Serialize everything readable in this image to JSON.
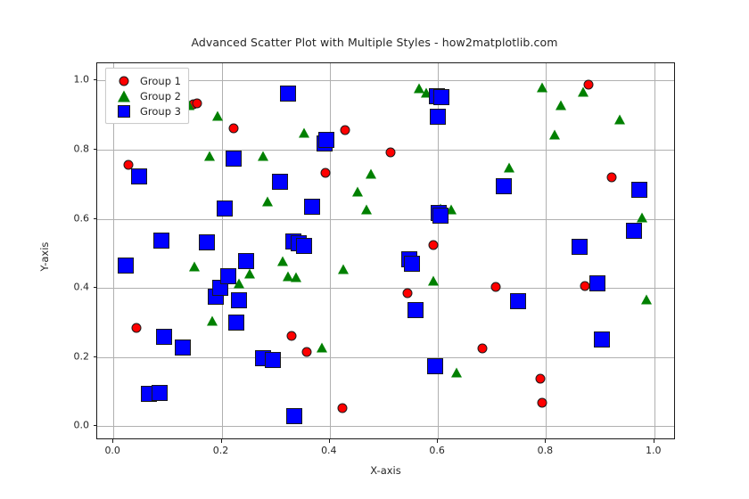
{
  "chart_data": {
    "type": "scatter",
    "title": "Advanced Scatter Plot with Multiple Styles - how2matplotlib.com",
    "xlabel": "X-axis",
    "ylabel": "Y-axis",
    "xlim": [
      -0.03,
      1.04
    ],
    "ylim": [
      -0.04,
      1.05
    ],
    "xticks": [
      0.0,
      0.2,
      0.4,
      0.6,
      0.8,
      1.0
    ],
    "yticks": [
      0.0,
      0.2,
      0.4,
      0.6,
      0.8,
      1.0
    ],
    "xtick_labels": [
      "0.0",
      "0.2",
      "0.4",
      "0.6",
      "0.8",
      "1.0"
    ],
    "ytick_labels": [
      "0.0",
      "0.2",
      "0.4",
      "0.6",
      "0.8",
      "1.0"
    ],
    "grid": true,
    "legend_position": "upper left",
    "series": [
      {
        "name": "Group 1",
        "marker": "circle",
        "color": "#ff0000",
        "edge_color": "#1a1a1a",
        "size": 11,
        "points": [
          [
            0.028,
            0.755
          ],
          [
            0.043,
            0.285
          ],
          [
            0.148,
            0.932
          ],
          [
            0.155,
            0.933
          ],
          [
            0.222,
            0.863
          ],
          [
            0.33,
            0.262
          ],
          [
            0.358,
            0.215
          ],
          [
            0.392,
            0.733
          ],
          [
            0.424,
            0.053
          ],
          [
            0.428,
            0.858
          ],
          [
            0.513,
            0.792
          ],
          [
            0.543,
            0.385
          ],
          [
            0.592,
            0.525
          ],
          [
            0.683,
            0.226
          ],
          [
            0.707,
            0.404
          ],
          [
            0.79,
            0.138
          ],
          [
            0.793,
            0.067
          ],
          [
            0.872,
            0.405
          ],
          [
            0.878,
            0.988
          ],
          [
            0.922,
            0.72
          ]
        ]
      },
      {
        "name": "Group 2",
        "marker": "triangle",
        "color": "#008000",
        "edge_color": "#1a1a1a",
        "size": 13,
        "points": [
          [
            0.14,
            0.93
          ],
          [
            0.15,
            0.462
          ],
          [
            0.178,
            0.781
          ],
          [
            0.182,
            0.305
          ],
          [
            0.192,
            0.897
          ],
          [
            0.232,
            0.414
          ],
          [
            0.252,
            0.442
          ],
          [
            0.276,
            0.783
          ],
          [
            0.285,
            0.65
          ],
          [
            0.313,
            0.477
          ],
          [
            0.322,
            0.435
          ],
          [
            0.337,
            0.431
          ],
          [
            0.352,
            0.848
          ],
          [
            0.385,
            0.228
          ],
          [
            0.425,
            0.455
          ],
          [
            0.452,
            0.68
          ],
          [
            0.468,
            0.628
          ],
          [
            0.476,
            0.731
          ],
          [
            0.565,
            0.978
          ],
          [
            0.578,
            0.966
          ],
          [
            0.592,
            0.42
          ],
          [
            0.604,
            0.63
          ],
          [
            0.624,
            0.627
          ],
          [
            0.635,
            0.155
          ],
          [
            0.732,
            0.748
          ],
          [
            0.792,
            0.98
          ],
          [
            0.815,
            0.845
          ],
          [
            0.828,
            0.93
          ],
          [
            0.868,
            0.968
          ],
          [
            0.936,
            0.888
          ],
          [
            0.978,
            0.604
          ],
          [
            0.985,
            0.368
          ]
        ]
      },
      {
        "name": "Group 3",
        "marker": "square",
        "color": "#0000ff",
        "edge_color": "#1a1a1a",
        "size": 18,
        "points": [
          [
            0.022,
            0.464
          ],
          [
            0.048,
            0.722
          ],
          [
            0.065,
            0.095
          ],
          [
            0.085,
            0.096
          ],
          [
            0.088,
            0.538
          ],
          [
            0.093,
            0.258
          ],
          [
            0.128,
            0.228
          ],
          [
            0.172,
            0.533
          ],
          [
            0.19,
            0.375
          ],
          [
            0.198,
            0.4
          ],
          [
            0.205,
            0.63
          ],
          [
            0.213,
            0.435
          ],
          [
            0.222,
            0.775
          ],
          [
            0.228,
            0.3
          ],
          [
            0.232,
            0.365
          ],
          [
            0.245,
            0.478
          ],
          [
            0.277,
            0.196
          ],
          [
            0.295,
            0.192
          ],
          [
            0.308,
            0.706
          ],
          [
            0.322,
            0.962
          ],
          [
            0.332,
            0.535
          ],
          [
            0.335,
            0.03
          ],
          [
            0.342,
            0.53
          ],
          [
            0.352,
            0.522
          ],
          [
            0.368,
            0.634
          ],
          [
            0.39,
            0.818
          ],
          [
            0.393,
            0.828
          ],
          [
            0.547,
            0.482
          ],
          [
            0.552,
            0.47
          ],
          [
            0.558,
            0.337
          ],
          [
            0.595,
            0.174
          ],
          [
            0.598,
            0.955
          ],
          [
            0.6,
            0.895
          ],
          [
            0.602,
            0.618
          ],
          [
            0.605,
            0.61
          ],
          [
            0.607,
            0.952
          ],
          [
            0.722,
            0.695
          ],
          [
            0.748,
            0.362
          ],
          [
            0.862,
            0.518
          ],
          [
            0.895,
            0.413
          ],
          [
            0.903,
            0.252
          ],
          [
            0.962,
            0.565
          ],
          [
            0.972,
            0.685
          ]
        ]
      }
    ]
  },
  "legend": {
    "entries": [
      {
        "label": "Group 1"
      },
      {
        "label": "Group 2"
      },
      {
        "label": "Group 3"
      }
    ]
  }
}
